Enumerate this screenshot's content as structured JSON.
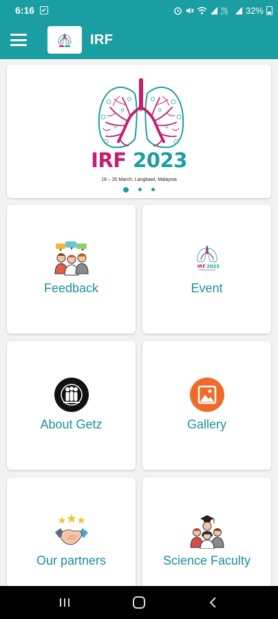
{
  "status_bar": {
    "time": "6:16",
    "battery": "32%",
    "icons": [
      "notification-icon",
      "alarm-icon",
      "mute-icon",
      "wifi-icon",
      "signal-icon",
      "volte-icon",
      "signal-icon",
      "battery-icon"
    ]
  },
  "app_bar": {
    "title": "IRF",
    "menu_icon": "hamburger-menu-icon"
  },
  "banner": {
    "title_part1": "IRF",
    "title_part2": "2023",
    "subtitle": "18 – 20 March, Langkawi, Malaysia",
    "slides": 3,
    "active_slide": 0
  },
  "tiles": [
    {
      "label": "Feedback",
      "icon": "feedback-people-icon"
    },
    {
      "label": "Event",
      "icon": "irf-logo-icon"
    },
    {
      "label": "About Getz",
      "icon": "group-circle-icon"
    },
    {
      "label": "Gallery",
      "icon": "image-circle-icon"
    },
    {
      "label": "Our partners",
      "icon": "handshake-stars-icon"
    },
    {
      "label": "Science Faculty",
      "icon": "faculty-people-icon"
    }
  ],
  "colors": {
    "primary": "#1b9ea1",
    "accent": "#c41f6e",
    "label": "#1b8fa0",
    "gallery_icon": "#f06a2a"
  },
  "nav_bar": [
    "recent-apps-icon",
    "home-icon",
    "back-icon"
  ]
}
